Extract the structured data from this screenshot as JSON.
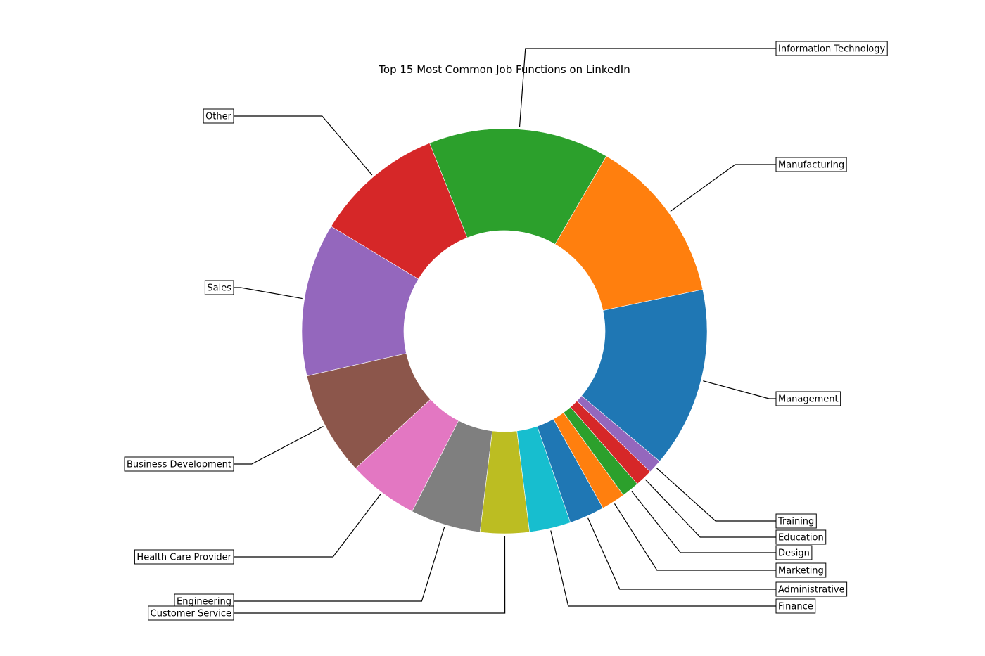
{
  "chart_data": {
    "type": "pie",
    "variant": "donut",
    "title": "Top 15 Most Common Job Functions on LinkedIn",
    "unit": "share of total (percent, estimated from slice angles)",
    "start": "Management slice first, proceeding counterclockwise",
    "slices": [
      {
        "label": "Management",
        "value": 14.4,
        "color": "#1f77b4"
      },
      {
        "label": "Manufacturing",
        "value": 13.3,
        "color": "#ff7f0e"
      },
      {
        "label": "Information Technology",
        "value": 14.4,
        "color": "#2ca02c"
      },
      {
        "label": "Other",
        "value": 10.3,
        "color": "#d62728"
      },
      {
        "label": "Sales",
        "value": 12.2,
        "color": "#9467bd"
      },
      {
        "label": "Business Development",
        "value": 8.3,
        "color": "#8c564b"
      },
      {
        "label": "Health Care Provider",
        "value": 5.6,
        "color": "#e377c2"
      },
      {
        "label": "Engineering",
        "value": 5.6,
        "color": "#7f7f7f"
      },
      {
        "label": "Customer Service",
        "value": 3.9,
        "color": "#bcbd22"
      },
      {
        "label": "Finance",
        "value": 3.3,
        "color": "#17becf"
      },
      {
        "label": "Administrative",
        "value": 2.8,
        "color": "#1f77b4"
      },
      {
        "label": "Marketing",
        "value": 1.9,
        "color": "#ff7f0e"
      },
      {
        "label": "Design",
        "value": 1.4,
        "color": "#2ca02c"
      },
      {
        "label": "Education",
        "value": 1.4,
        "color": "#d62728"
      },
      {
        "label": "Training",
        "value": 1.1,
        "color": "#9467bd"
      }
    ],
    "legend": "none (boxed annotation labels with leader lines)"
  }
}
